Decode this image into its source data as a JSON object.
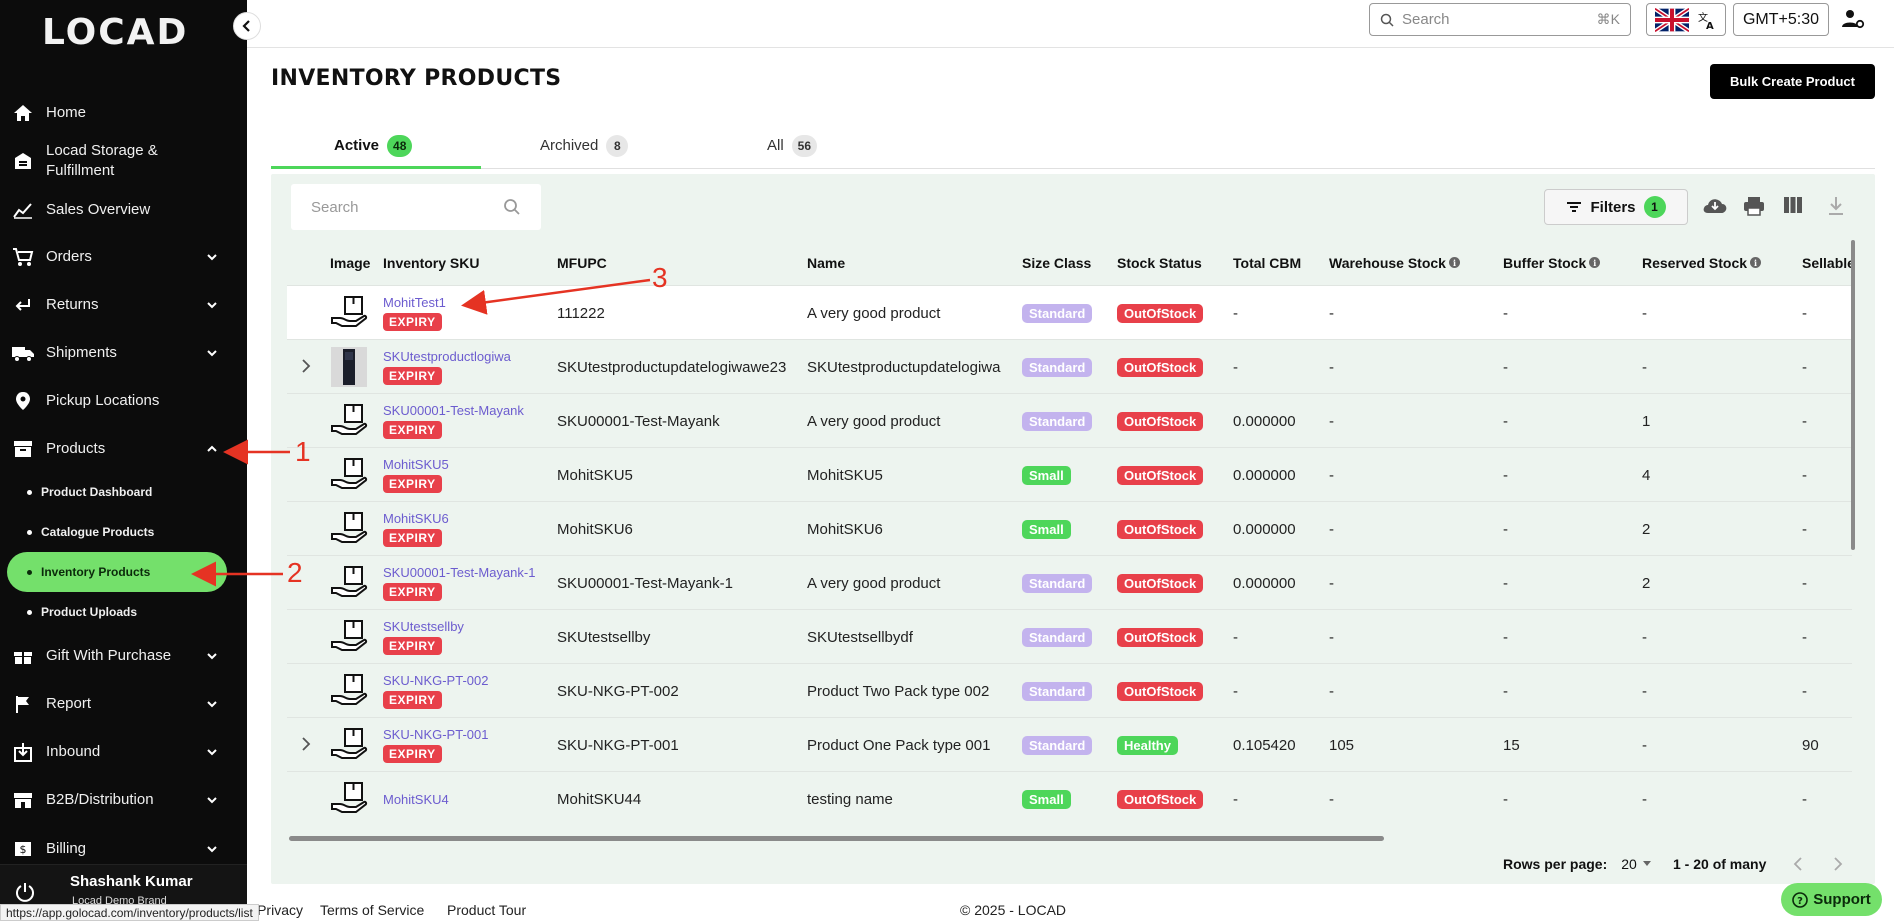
{
  "brand": {
    "logo": "LOCAD"
  },
  "topbar": {
    "search_placeholder": "Search",
    "search_shortcut": "⌘K",
    "timezone": "GMT+5:30"
  },
  "sidebar": {
    "items": [
      {
        "label": "Home",
        "icon": "home-icon"
      },
      {
        "label": "Locad Storage & Fulfillment",
        "icon": "warehouse-icon"
      },
      {
        "label": "Sales Overview",
        "icon": "chart-icon"
      },
      {
        "label": "Orders",
        "icon": "cart-icon"
      },
      {
        "label": "Returns",
        "icon": "return-icon"
      },
      {
        "label": "Shipments",
        "icon": "truck-icon"
      },
      {
        "label": "Pickup Locations",
        "icon": "location-pin-icon"
      },
      {
        "label": "Products",
        "icon": "box-icon"
      },
      {
        "label": "Gift With Purchase",
        "icon": "gift-icon"
      },
      {
        "label": "Report",
        "icon": "flag-icon"
      },
      {
        "label": "Inbound",
        "icon": "inbound-icon"
      },
      {
        "label": "B2B/Distribution",
        "icon": "store-icon"
      },
      {
        "label": "Billing",
        "icon": "billing-icon"
      }
    ],
    "sub_items": [
      {
        "label": "Product Dashboard"
      },
      {
        "label": "Catalogue Products"
      },
      {
        "label": "Inventory Products",
        "active": true
      },
      {
        "label": "Product Uploads"
      }
    ],
    "user": {
      "name": "Shashank Kumar",
      "brand": "Locad Demo Brand"
    }
  },
  "status_url": "https://app.golocad.com/inventory/products/list",
  "page": {
    "title": "INVENTORY PRODUCTS",
    "bulk_button": "Bulk Create Product"
  },
  "tabs": [
    {
      "label": "Active",
      "count": "48",
      "active": true
    },
    {
      "label": "Archived",
      "count": "8"
    },
    {
      "label": "All",
      "count": "56"
    }
  ],
  "table": {
    "search_placeholder": "Search",
    "filters_label": "Filters",
    "filters_count": "1",
    "headers": [
      "Image",
      "Inventory SKU",
      "MFUPC",
      "Name",
      "Size Class",
      "Stock Status",
      "Total CBM",
      "Warehouse Stock",
      "Buffer Stock",
      "Reserved Stock",
      "Sellable"
    ],
    "rows": [
      {
        "sku": "MohitTest1",
        "expiry": "EXPIRY",
        "mfupc": "111222",
        "name": "A very good product",
        "size": "Standard",
        "status": "OutOfStock",
        "cbm": "-",
        "warehouse": "-",
        "buffer": "-",
        "reserved": "-",
        "sellable": "-",
        "expandable": false
      },
      {
        "sku": "SKUtestproductlogiwa",
        "expiry": "EXPIRY",
        "mfupc": "SKUtestproductupdatelogiwawe23",
        "name": "SKUtestproductupdatelogiwa",
        "size": "Standard",
        "status": "OutOfStock",
        "cbm": "-",
        "warehouse": "-",
        "buffer": "-",
        "reserved": "-",
        "sellable": "-",
        "expandable": true
      },
      {
        "sku": "SKU00001-Test-Mayank",
        "expiry": "EXPIRY",
        "mfupc": "SKU00001-Test-Mayank",
        "name": "A very good product",
        "size": "Standard",
        "status": "OutOfStock",
        "cbm": "0.000000",
        "warehouse": "-",
        "buffer": "-",
        "reserved": "1",
        "sellable": "-",
        "expandable": false
      },
      {
        "sku": "MohitSKU5",
        "expiry": "EXPIRY",
        "mfupc": "MohitSKU5",
        "name": "MohitSKU5",
        "size": "Small",
        "status": "OutOfStock",
        "cbm": "0.000000",
        "warehouse": "-",
        "buffer": "-",
        "reserved": "4",
        "sellable": "-",
        "expandable": false
      },
      {
        "sku": "MohitSKU6",
        "expiry": "EXPIRY",
        "mfupc": "MohitSKU6",
        "name": "MohitSKU6",
        "size": "Small",
        "status": "OutOfStock",
        "cbm": "0.000000",
        "warehouse": "-",
        "buffer": "-",
        "reserved": "2",
        "sellable": "-",
        "expandable": false
      },
      {
        "sku": "SKU00001-Test-Mayank-1",
        "expiry": "EXPIRY",
        "mfupc": "SKU00001-Test-Mayank-1",
        "name": "A very good product",
        "size": "Standard",
        "status": "OutOfStock",
        "cbm": "0.000000",
        "warehouse": "-",
        "buffer": "-",
        "reserved": "2",
        "sellable": "-",
        "expandable": false
      },
      {
        "sku": "SKUtestsellby",
        "expiry": "EXPIRY",
        "mfupc": "SKUtestsellby",
        "name": "SKUtestsellbydf",
        "size": "Standard",
        "status": "OutOfStock",
        "cbm": "-",
        "warehouse": "-",
        "buffer": "-",
        "reserved": "-",
        "sellable": "-",
        "expandable": false
      },
      {
        "sku": "SKU-NKG-PT-002",
        "expiry": "EXPIRY",
        "mfupc": "SKU-NKG-PT-002",
        "name": "Product Two Pack type 002",
        "size": "Standard",
        "status": "OutOfStock",
        "cbm": "-",
        "warehouse": "-",
        "buffer": "-",
        "reserved": "-",
        "sellable": "-",
        "expandable": false
      },
      {
        "sku": "SKU-NKG-PT-001",
        "expiry": "EXPIRY",
        "mfupc": "SKU-NKG-PT-001",
        "name": "Product One Pack type 001",
        "size": "Standard",
        "status": "Healthy",
        "cbm": "0.105420",
        "warehouse": "105",
        "buffer": "15",
        "reserved": "-",
        "sellable": "90",
        "expandable": true
      },
      {
        "sku": "MohitSKU4",
        "expiry": "",
        "mfupc": "MohitSKU44",
        "name": "testing name",
        "size": "Small",
        "status": "OutOfStock",
        "cbm": "-",
        "warehouse": "-",
        "buffer": "-",
        "reserved": "-",
        "sellable": "-",
        "expandable": false
      }
    ]
  },
  "pager": {
    "rows_per_page_label": "Rows per page:",
    "rows_per_page": "20",
    "range": "1 - 20 of many"
  },
  "footer": {
    "privacy": "Privacy",
    "terms": "Terms of Service",
    "tour": "Product Tour",
    "copyright": "© 2025 - LOCAD"
  },
  "support_label": "Support",
  "annotations": [
    "1",
    "2",
    "3"
  ],
  "colors": {
    "accent_green": "#4dd65a",
    "expiry_red": "#e8404a",
    "standard_purple": "#c3b3ee",
    "link_purple": "#6c5ccf",
    "annotation_red": "#e53323"
  }
}
